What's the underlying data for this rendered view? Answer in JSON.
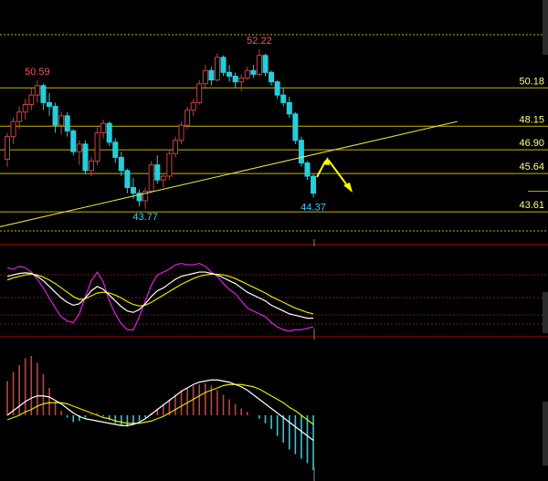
{
  "chart_data": {
    "type": "candlestick",
    "colors": {
      "background": "#000000",
      "up": "#d23c3c",
      "down": "#20d0e0",
      "level": "#c8b400",
      "trendline": "#e6e64a",
      "arrow": "#ffff00",
      "divider": "#b00000",
      "grid_dotted": "#7a1a1a",
      "label_high": "#ff5050",
      "label_low": "#40c8ff",
      "label_level": "#ffff80",
      "kdj_k": "#ffffff",
      "kdj_d": "#e6e600",
      "kdj_j": "#e020e0",
      "macd_dif": "#ffffff",
      "macd_dea": "#e6e600"
    },
    "price_range": [
      42.6,
      53.0
    ],
    "candles": [
      [
        46.4,
        47.8,
        46.0,
        47.6
      ],
      [
        47.6,
        48.6,
        47.2,
        48.4
      ],
      [
        48.4,
        49.2,
        48.0,
        48.9
      ],
      [
        48.9,
        49.6,
        48.5,
        49.3
      ],
      [
        49.3,
        50.2,
        49.0,
        49.8
      ],
      [
        49.8,
        50.59,
        49.4,
        50.3
      ],
      [
        50.3,
        50.4,
        49.0,
        49.4
      ],
      [
        49.4,
        49.9,
        48.7,
        49.2
      ],
      [
        49.2,
        49.4,
        47.8,
        48.2
      ],
      [
        48.2,
        48.9,
        47.7,
        48.7
      ],
      [
        48.7,
        48.9,
        47.6,
        47.9
      ],
      [
        47.9,
        48.0,
        46.6,
        46.8
      ],
      [
        46.8,
        47.4,
        46.1,
        47.2
      ],
      [
        47.2,
        47.4,
        45.6,
        45.8
      ],
      [
        45.8,
        46.5,
        45.5,
        46.3
      ],
      [
        46.3,
        48.1,
        46.1,
        47.8
      ],
      [
        47.8,
        48.5,
        47.5,
        48.3
      ],
      [
        48.3,
        48.4,
        47.1,
        47.3
      ],
      [
        47.3,
        47.5,
        46.2,
        46.5
      ],
      [
        46.5,
        46.8,
        45.5,
        45.8
      ],
      [
        45.8,
        45.9,
        44.6,
        44.9
      ],
      [
        44.9,
        45.4,
        44.3,
        44.6
      ],
      [
        44.6,
        44.8,
        43.9,
        44.2
      ],
      [
        44.2,
        44.9,
        43.77,
        44.7
      ],
      [
        44.7,
        46.3,
        44.6,
        46.1
      ],
      [
        46.1,
        46.6,
        45.1,
        45.3
      ],
      [
        45.3,
        45.6,
        44.9,
        45.5
      ],
      [
        45.5,
        46.9,
        45.3,
        46.7
      ],
      [
        46.7,
        47.6,
        46.5,
        47.4
      ],
      [
        47.4,
        48.4,
        47.2,
        48.2
      ],
      [
        48.2,
        49.2,
        48.0,
        49.0
      ],
      [
        49.0,
        49.6,
        48.7,
        49.4
      ],
      [
        49.4,
        50.6,
        49.3,
        50.4
      ],
      [
        50.4,
        51.4,
        50.2,
        51.1
      ],
      [
        51.1,
        51.3,
        50.3,
        50.6
      ],
      [
        50.6,
        52.0,
        50.5,
        51.8
      ],
      [
        51.8,
        51.9,
        50.8,
        51.0
      ],
      [
        51.0,
        51.4,
        50.5,
        50.8
      ],
      [
        50.8,
        51.0,
        50.2,
        50.5
      ],
      [
        50.5,
        50.9,
        50.0,
        50.7
      ],
      [
        50.7,
        51.3,
        50.6,
        51.1
      ],
      [
        51.1,
        51.4,
        50.7,
        50.9
      ],
      [
        50.9,
        52.22,
        50.8,
        51.9
      ],
      [
        51.9,
        52.0,
        50.8,
        51.0
      ],
      [
        51.0,
        51.1,
        50.3,
        50.5
      ],
      [
        50.5,
        50.6,
        49.6,
        49.8
      ],
      [
        49.8,
        50.2,
        49.2,
        49.4
      ],
      [
        49.4,
        49.7,
        48.6,
        48.8
      ],
      [
        48.8,
        48.9,
        47.2,
        47.4
      ],
      [
        47.4,
        47.6,
        46.0,
        46.2
      ],
      [
        46.2,
        46.3,
        45.3,
        45.5
      ],
      [
        45.5,
        45.6,
        44.37,
        44.6
      ]
    ],
    "levels": [
      50.18,
      48.15,
      46.9,
      45.64,
      43.61
    ],
    "level_labels": [
      "50.18",
      "48.15",
      "46.90",
      "45.64",
      "43.61"
    ],
    "annotations": {
      "high_left": {
        "text": "50.59",
        "candle": 5,
        "price": 50.59
      },
      "high_peak": {
        "text": "52.22",
        "candle": 42,
        "price": 52.22
      },
      "low_mid": {
        "text": "43.77",
        "candle": 23,
        "price": 43.77
      },
      "low_last": {
        "text": "44.37",
        "candle": 51,
        "price": 44.37
      }
    },
    "trendline": {
      "from": [
        -1.5,
        42.8
      ],
      "to": [
        75,
        48.4
      ]
    },
    "kdj": {
      "k": [
        80,
        82,
        84,
        85,
        84,
        80,
        74,
        66,
        58,
        50,
        44,
        40,
        42,
        50,
        60,
        66,
        62,
        54,
        46,
        38,
        32,
        30,
        34,
        42,
        52,
        60,
        64,
        70,
        76,
        80,
        82,
        84,
        86,
        86,
        84,
        82,
        78,
        74,
        70,
        64,
        58,
        54,
        50,
        46,
        40,
        36,
        32,
        28,
        26,
        24,
        22,
        22
      ],
      "d": [
        75,
        78,
        80,
        82,
        83,
        82,
        79,
        75,
        70,
        64,
        58,
        52,
        48,
        49,
        53,
        57,
        58,
        57,
        54,
        50,
        45,
        41,
        39,
        40,
        44,
        49,
        54,
        59,
        64,
        69,
        73,
        77,
        80,
        82,
        83,
        83,
        82,
        80,
        77,
        73,
        69,
        65,
        61,
        57,
        52,
        48,
        44,
        40,
        36,
        33,
        30,
        28
      ],
      "j": [
        92,
        90,
        94,
        92,
        86,
        76,
        64,
        50,
        36,
        24,
        18,
        16,
        28,
        52,
        74,
        86,
        72,
        46,
        28,
        14,
        6,
        6,
        24,
        46,
        68,
        82,
        86,
        90,
        96,
        98,
        96,
        96,
        98,
        94,
        86,
        80,
        70,
        62,
        56,
        46,
        36,
        32,
        28,
        24,
        16,
        10,
        6,
        4,
        6,
        6,
        8,
        10
      ]
    },
    "macd": {
      "hist": [
        0.3,
        0.38,
        0.44,
        0.5,
        0.52,
        0.46,
        0.36,
        0.24,
        0.12,
        0.04,
        -0.02,
        -0.06,
        -0.05,
        -0.02,
        0.01,
        0.02,
        -0.01,
        -0.04,
        -0.07,
        -0.09,
        -0.1,
        -0.08,
        -0.05,
        -0.02,
        0.02,
        0.06,
        0.1,
        0.14,
        0.18,
        0.22,
        0.24,
        0.26,
        0.27,
        0.28,
        0.26,
        0.22,
        0.18,
        0.14,
        0.1,
        0.06,
        0.03,
        0.0,
        -0.03,
        -0.07,
        -0.12,
        -0.18,
        -0.24,
        -0.3,
        -0.34,
        -0.38,
        -0.42,
        -0.48
      ],
      "dif": [
        0.0,
        0.04,
        0.08,
        0.12,
        0.15,
        0.17,
        0.17,
        0.16,
        0.13,
        0.1,
        0.06,
        0.02,
        -0.01,
        -0.03,
        -0.04,
        -0.05,
        -0.06,
        -0.07,
        -0.08,
        -0.09,
        -0.09,
        -0.08,
        -0.06,
        -0.03,
        0.01,
        0.05,
        0.09,
        0.13,
        0.17,
        0.21,
        0.24,
        0.27,
        0.29,
        0.3,
        0.31,
        0.31,
        0.3,
        0.29,
        0.27,
        0.25,
        0.22,
        0.18,
        0.14,
        0.1,
        0.06,
        0.02,
        -0.02,
        -0.06,
        -0.1,
        -0.14,
        -0.18,
        -0.22
      ],
      "dea": [
        -0.04,
        -0.02,
        0.0,
        0.03,
        0.05,
        0.08,
        0.1,
        0.11,
        0.11,
        0.11,
        0.1,
        0.08,
        0.06,
        0.04,
        0.02,
        0.0,
        -0.02,
        -0.03,
        -0.05,
        -0.06,
        -0.07,
        -0.07,
        -0.07,
        -0.06,
        -0.05,
        -0.03,
        -0.01,
        0.02,
        0.05,
        0.08,
        0.11,
        0.14,
        0.17,
        0.2,
        0.22,
        0.24,
        0.26,
        0.27,
        0.27,
        0.27,
        0.26,
        0.25,
        0.23,
        0.2,
        0.17,
        0.14,
        0.11,
        0.07,
        0.04,
        0.0,
        -0.04,
        -0.08
      ]
    }
  }
}
